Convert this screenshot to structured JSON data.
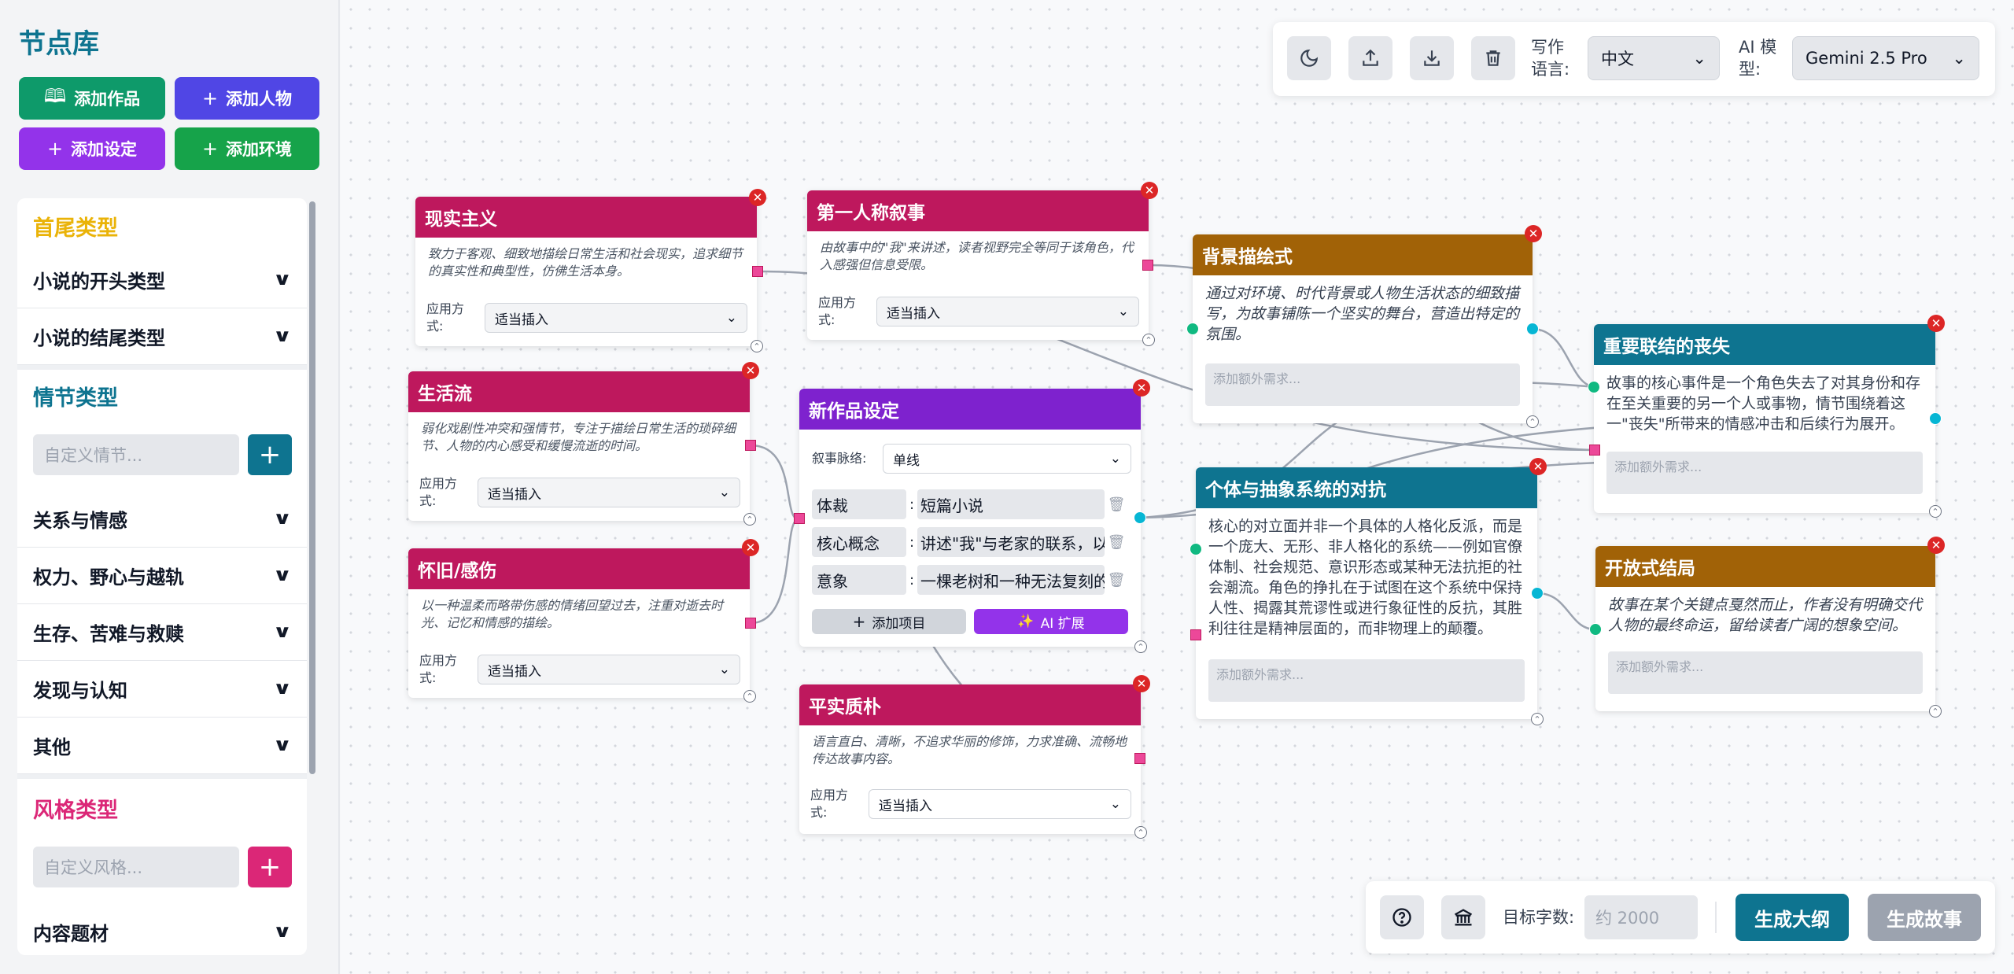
{
  "sidebar": {
    "title": "节点库",
    "add_buttons": [
      {
        "label": "添加作品",
        "icon": "book-icon",
        "color": "#0e9a6a"
      },
      {
        "label": "添加人物",
        "icon": "plus-icon",
        "color": "#5046e5"
      },
      {
        "label": "添加设定",
        "icon": "plus-icon",
        "color": "#9333ea"
      },
      {
        "label": "添加环境",
        "icon": "plus-icon",
        "color": "#16a34a"
      }
    ],
    "sections": {
      "head_tail": {
        "title": "首尾类型",
        "color": "#eab308",
        "items": [
          "小说的开头类型",
          "小说的结尾类型"
        ]
      },
      "plot": {
        "title": "情节类型",
        "color": "#0e7490",
        "placeholder": "自定义情节...",
        "items": [
          "关系与情感",
          "权力、野心与越轨",
          "生存、苦难与救赎",
          "发现与认知",
          "其他"
        ]
      },
      "style": {
        "title": "风格类型",
        "color": "#db2777",
        "placeholder": "自定义风格...",
        "items": [
          "内容题材"
        ]
      }
    }
  },
  "toolbar": {
    "icons": [
      "moon-icon",
      "upload-icon",
      "download-icon",
      "trash-icon"
    ],
    "lang_label": "写作语言:",
    "lang_value": "中文",
    "model_label": "AI 模型:",
    "model_value": "Gemini 2.5 Pro"
  },
  "bottombar": {
    "target_label": "目标字数:",
    "target_placeholder": "约 2000",
    "outline_btn": "生成大纲",
    "story_btn": "生成故事"
  },
  "nodes": {
    "realism": {
      "title": "现实主义",
      "color": "#be185d",
      "desc": "致力于客观、细致地描绘日常生活和社会现实，追求细节的真实性和典型性，仿佛生活本身。",
      "apply_label": "应用方式:",
      "apply_value": "适当插入"
    },
    "life": {
      "title": "生活流",
      "color": "#be185d",
      "desc": "弱化戏剧性冲突和强情节，专注于描绘日常生活的琐碎细节、人物的内心感受和缓慢流逝的时间。",
      "apply_label": "应用方式:",
      "apply_value": "适当插入"
    },
    "nostalgia": {
      "title": "怀旧/感伤",
      "color": "#be185d",
      "desc": "以一种温柔而略带伤感的情绪回望过去，注重对逝去时光、记忆和情感的描绘。",
      "apply_label": "应用方式:",
      "apply_value": "适当插入"
    },
    "first_person": {
      "title": "第一人称叙事",
      "color": "#be185d",
      "desc": "由故事中的\"我\"来讲述，读者视野完全等同于该角色，代入感强但信息受限。",
      "apply_label": "应用方式:",
      "apply_value": "适当插入"
    },
    "new_work": {
      "title": "新作品设定",
      "color": "#7e22ce",
      "narrative_label": "叙事脉络:",
      "narrative_value": "单线",
      "fields": [
        {
          "key": "体裁",
          "value": "短篇小说"
        },
        {
          "key": "核心概念",
          "value": "讲述\"我\"与老家的联系，以"
        },
        {
          "key": "意象",
          "value": "一棵老树和一种无法复刻的"
        }
      ],
      "add_item": "添加项目",
      "ai_expand": "AI 扩展"
    },
    "plain": {
      "title": "平实质朴",
      "color": "#be185d",
      "desc": "语言直白、清晰，不追求华丽的修饰，力求准确、流畅地传达故事内容。",
      "apply_label": "应用方式:",
      "apply_value": "适当插入"
    },
    "background": {
      "title": "背景描绘式",
      "color": "#a16207",
      "desc": "通过对环境、时代背景或人物生活状态的细致描写，为故事铺陈一个坚实的舞台，营造出特定的氛围。",
      "extra": "添加额外需求..."
    },
    "conflict": {
      "title": "个体与抽象系统的对抗",
      "color": "#0e7490",
      "desc": "核心的对立面并非一个具体的人格化反派，而是一个庞大、无形、非人格化的系统——例如官僚体制、社会规范、意识形态或某种无法抗拒的社会潮流。角色的挣扎在于试图在这个系统中保持人性、揭露其荒谬性或进行象征性的反抗，其胜利往往是精神层面的，而非物理上的颠覆。",
      "extra": "添加额外需求..."
    },
    "loss": {
      "title": "重要联结的丧失",
      "color": "#0e7490",
      "desc": "故事的核心事件是一个角色失去了对其身份和存在至关重要的另一个人或事物，情节围绕着这一\"丧失\"所带来的情感冲击和后续行为展开。",
      "extra": "添加额外需求..."
    },
    "open_end": {
      "title": "开放式结局",
      "color": "#a16207",
      "desc": "故事在某个关键点戛然而止，作者没有明确交代人物的最终命运，留给读者广阔的想象空间。",
      "extra": "添加额外需求..."
    }
  }
}
